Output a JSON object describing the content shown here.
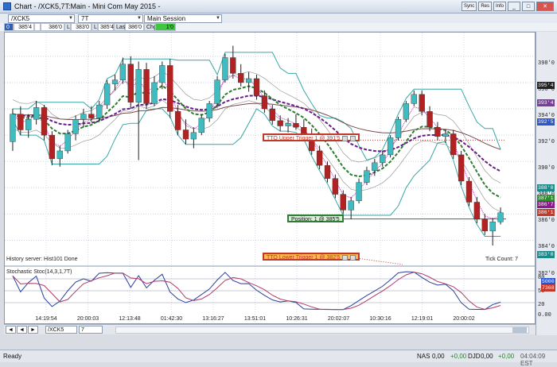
{
  "window": {
    "title": "Chart - /XCK5,7T:Main - Mini Com May 2015 -",
    "btn_sync": "Sync",
    "btn_res": "Res",
    "btn_info": "Info"
  },
  "toolbar": {
    "symbol": "/XCK5",
    "interval": "7T",
    "session": "Main Session"
  },
  "quote": {
    "bid_size": "0",
    "bid": "385'4",
    "ask": "386'0",
    "low_label": "L",
    "low": "383'0",
    "high_label": "L",
    "high": "385'4",
    "last_label": "Last",
    "last": "386'0",
    "chg_label": "Chg",
    "chg": "1'0"
  },
  "chart": {
    "y_ticks": [
      "398'0",
      "396'0",
      "394'0",
      "392'0",
      "390'0",
      "388'0",
      "386'0",
      "384'0",
      "382'0"
    ],
    "x_ticks": [
      "14:19:54",
      "20:00:03",
      "12:13:48",
      "01:42:30",
      "13:16:27",
      "13:51:01",
      "10:26:31",
      "20:02:07",
      "10:30:16",
      "12:19:01",
      "20:00:02"
    ],
    "price_badges": [
      {
        "text": "395'4",
        "color": "#222222"
      },
      {
        "text": "393'4",
        "color": "#7a3b9b"
      },
      {
        "text": "392'5",
        "color": "#2b55c9"
      },
      {
        "text": "388'0",
        "color": "#1a8a8a"
      },
      {
        "text": "387'1",
        "color": "#2e8b2e"
      },
      {
        "text": "386'7",
        "color": "#8b1a8b"
      },
      {
        "text": "386'1",
        "color": "#c0392b"
      },
      {
        "text": "383'0",
        "color": "#1a8a8a"
      }
    ],
    "upper_trigger": "TTO Upper Trigger 1 @ 391'5",
    "lower_trigger": "TTO Lower Trigger 1 @ 382'5",
    "position": "Position: 1 @ 385'5",
    "history_status": "History server: Hist101 Done",
    "tick_count": "Tick Count: 7",
    "stoch_label": "Stochastic Stoc(14,3,1,7T)",
    "stoch_ticks": [
      "80",
      "50",
      "20",
      "0.00"
    ],
    "stoch_badges": [
      {
        "text": "5000",
        "color": "#2b55c9"
      },
      {
        "text": "7368",
        "color": "#c0392b"
      }
    ],
    "candles": [
      [
        391.5,
        394,
        390.8,
        393.6
      ],
      [
        393.6,
        394.2,
        392,
        392.4
      ],
      [
        392.4,
        393.6,
        391.8,
        393.2
      ],
      [
        393.2,
        394.6,
        392.8,
        394.1
      ],
      [
        394.1,
        394.3,
        391.6,
        392
      ],
      [
        392,
        392.3,
        389.7,
        390.2
      ],
      [
        390.2,
        391.2,
        389.6,
        390.8
      ],
      [
        390.8,
        392.4,
        390.6,
        392.1
      ],
      [
        392.1,
        393.5,
        391.6,
        393.2
      ],
      [
        393.2,
        394,
        392.6,
        393.6
      ],
      [
        393.6,
        394.2,
        393,
        393.3
      ],
      [
        393.3,
        394.6,
        393.1,
        394.3
      ],
      [
        394.3,
        396.2,
        394,
        395.9
      ],
      [
        395.9,
        396.6,
        395.4,
        396.2
      ],
      [
        396.2,
        397.9,
        395.9,
        397.4
      ],
      [
        397.4,
        398,
        394,
        394.5
      ],
      [
        394.5,
        397.6,
        390.1,
        397
      ],
      [
        397,
        397.5,
        394,
        394.4
      ],
      [
        394.4,
        396.5,
        394.2,
        396
      ],
      [
        396,
        397.6,
        395.5,
        397.3
      ],
      [
        397.3,
        397.8,
        393.3,
        393.8
      ],
      [
        393.8,
        394.3,
        392,
        392.4
      ],
      [
        392.4,
        393.2,
        391.3,
        391.7
      ],
      [
        391.7,
        392.6,
        391,
        392.2
      ],
      [
        392.2,
        393.6,
        392,
        393.3
      ],
      [
        393.3,
        394.6,
        393,
        394.4
      ],
      [
        394.4,
        396.5,
        394.1,
        396.2
      ],
      [
        396.2,
        398.2,
        396,
        397.9
      ],
      [
        397.9,
        398.8,
        396.3,
        396.7
      ],
      [
        396.7,
        397.4,
        395.7,
        396
      ],
      [
        396,
        396.8,
        395.3,
        396.3
      ],
      [
        396.3,
        396.6,
        394.7,
        395
      ],
      [
        395,
        395.4,
        393.7,
        394
      ],
      [
        394,
        394.3,
        392.8,
        393.1
      ],
      [
        393.1,
        393.5,
        392.3,
        392.7
      ],
      [
        392.7,
        393.3,
        392.2,
        392.9
      ],
      [
        392.9,
        393.6,
        392.4,
        392.6
      ],
      [
        392.6,
        393.2,
        391.8,
        392.1
      ],
      [
        392.1,
        392.5,
        390.5,
        390.8
      ],
      [
        390.8,
        391.2,
        389.4,
        389.7
      ],
      [
        389.7,
        390,
        388.4,
        388.7
      ],
      [
        388.7,
        389,
        387.2,
        387.5
      ],
      [
        387.5,
        387.8,
        386,
        386.3
      ],
      [
        386.3,
        387.3,
        385.6,
        387
      ],
      [
        387,
        388.7,
        386.8,
        388.4
      ],
      [
        388.4,
        389.6,
        388.2,
        389.3
      ],
      [
        389.3,
        390.2,
        388.9,
        389.9
      ],
      [
        389.9,
        390.8,
        389.6,
        390.5
      ],
      [
        390.5,
        392,
        390.3,
        391.8
      ],
      [
        391.8,
        393.4,
        391.6,
        393.2
      ],
      [
        393.2,
        394.6,
        393,
        394.4
      ],
      [
        394.4,
        395.4,
        394.2,
        395.1
      ],
      [
        395.1,
        395.4,
        393.5,
        393.8
      ],
      [
        393.8,
        394.2,
        392.3,
        392.6
      ],
      [
        392.6,
        393,
        391.6,
        391.9
      ],
      [
        391.9,
        392.4,
        391.4,
        392.1
      ],
      [
        392.1,
        392.4,
        390.2,
        390.5
      ],
      [
        390.5,
        390.8,
        388.2,
        388.5
      ],
      [
        388.5,
        388.8,
        386.6,
        386.9
      ],
      [
        386.9,
        387.3,
        385.3,
        385.6
      ],
      [
        385.6,
        386,
        384.4,
        384.7
      ],
      [
        384.7,
        385.7,
        383.6,
        385.4
      ],
      [
        385.4,
        386.5,
        385.2,
        386.1
      ]
    ]
  },
  "tabs": {
    "symbol_tab": "/XCK5",
    "interval_tab": "7"
  },
  "status": {
    "left": "Ready",
    "nas": "NAS",
    "nas_val": "0,00",
    "nas_chg": "+0,00",
    "djd": "DJD",
    "djd_val": "0,00",
    "djd_chg": "+0,00",
    "time": "04:04:09 EST"
  }
}
